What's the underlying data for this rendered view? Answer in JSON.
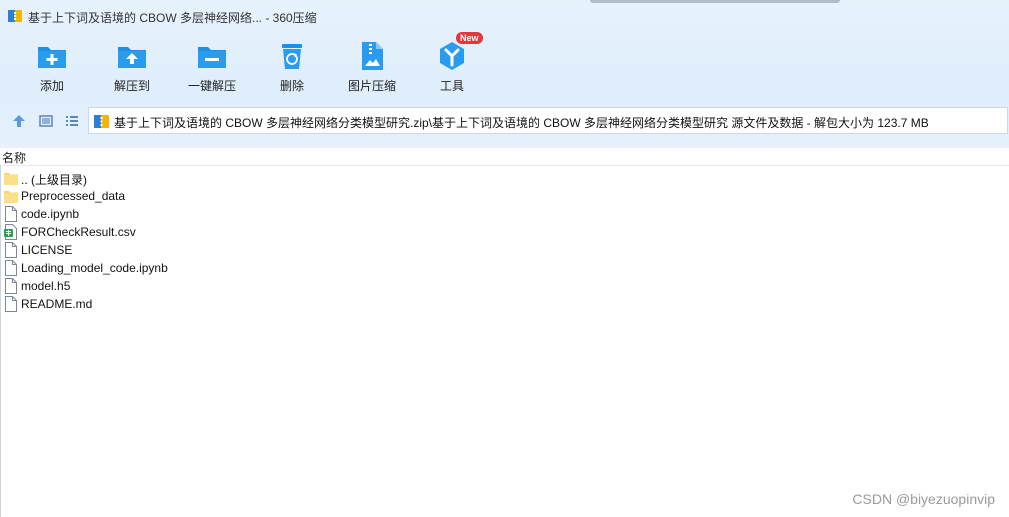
{
  "window": {
    "title": "基于上下词及语境的 CBOW 多层神经网络... - 360压缩"
  },
  "toolbar": {
    "items": [
      {
        "label": "添加",
        "icon": "add-folder-icon"
      },
      {
        "label": "解压到",
        "icon": "extract-to-icon"
      },
      {
        "label": "一键解压",
        "icon": "one-click-extract-icon"
      },
      {
        "label": "删除",
        "icon": "recycle-bin-icon"
      },
      {
        "label": "图片压缩",
        "icon": "image-compress-icon"
      },
      {
        "label": "工具",
        "icon": "tools-icon",
        "badge": "New"
      }
    ]
  },
  "address": {
    "path": "基于上下词及语境的 CBOW 多层神经网络分类模型研究.zip\\基于上下词及语境的 CBOW 多层神经网络分类模型研究 源文件及数据 - 解包大小为 123.7 MB"
  },
  "list": {
    "column_name": "名称",
    "files": [
      {
        "name": ".. (上级目录)",
        "type": "folder"
      },
      {
        "name": "Preprocessed_data",
        "type": "folder"
      },
      {
        "name": "code.ipynb",
        "type": "file"
      },
      {
        "name": "FORCheckResult.csv",
        "type": "csv"
      },
      {
        "name": "LICENSE",
        "type": "file"
      },
      {
        "name": "Loading_model_code.ipynb",
        "type": "file"
      },
      {
        "name": "model.h5",
        "type": "file"
      },
      {
        "name": "README.md",
        "type": "file"
      }
    ]
  },
  "watermark": "CSDN @biyezuopinvip",
  "colors": {
    "accent": "#1e8ee6",
    "chrome_bg": "#e3effc",
    "folder": "#f7d56b",
    "badge": "#e8343a"
  }
}
